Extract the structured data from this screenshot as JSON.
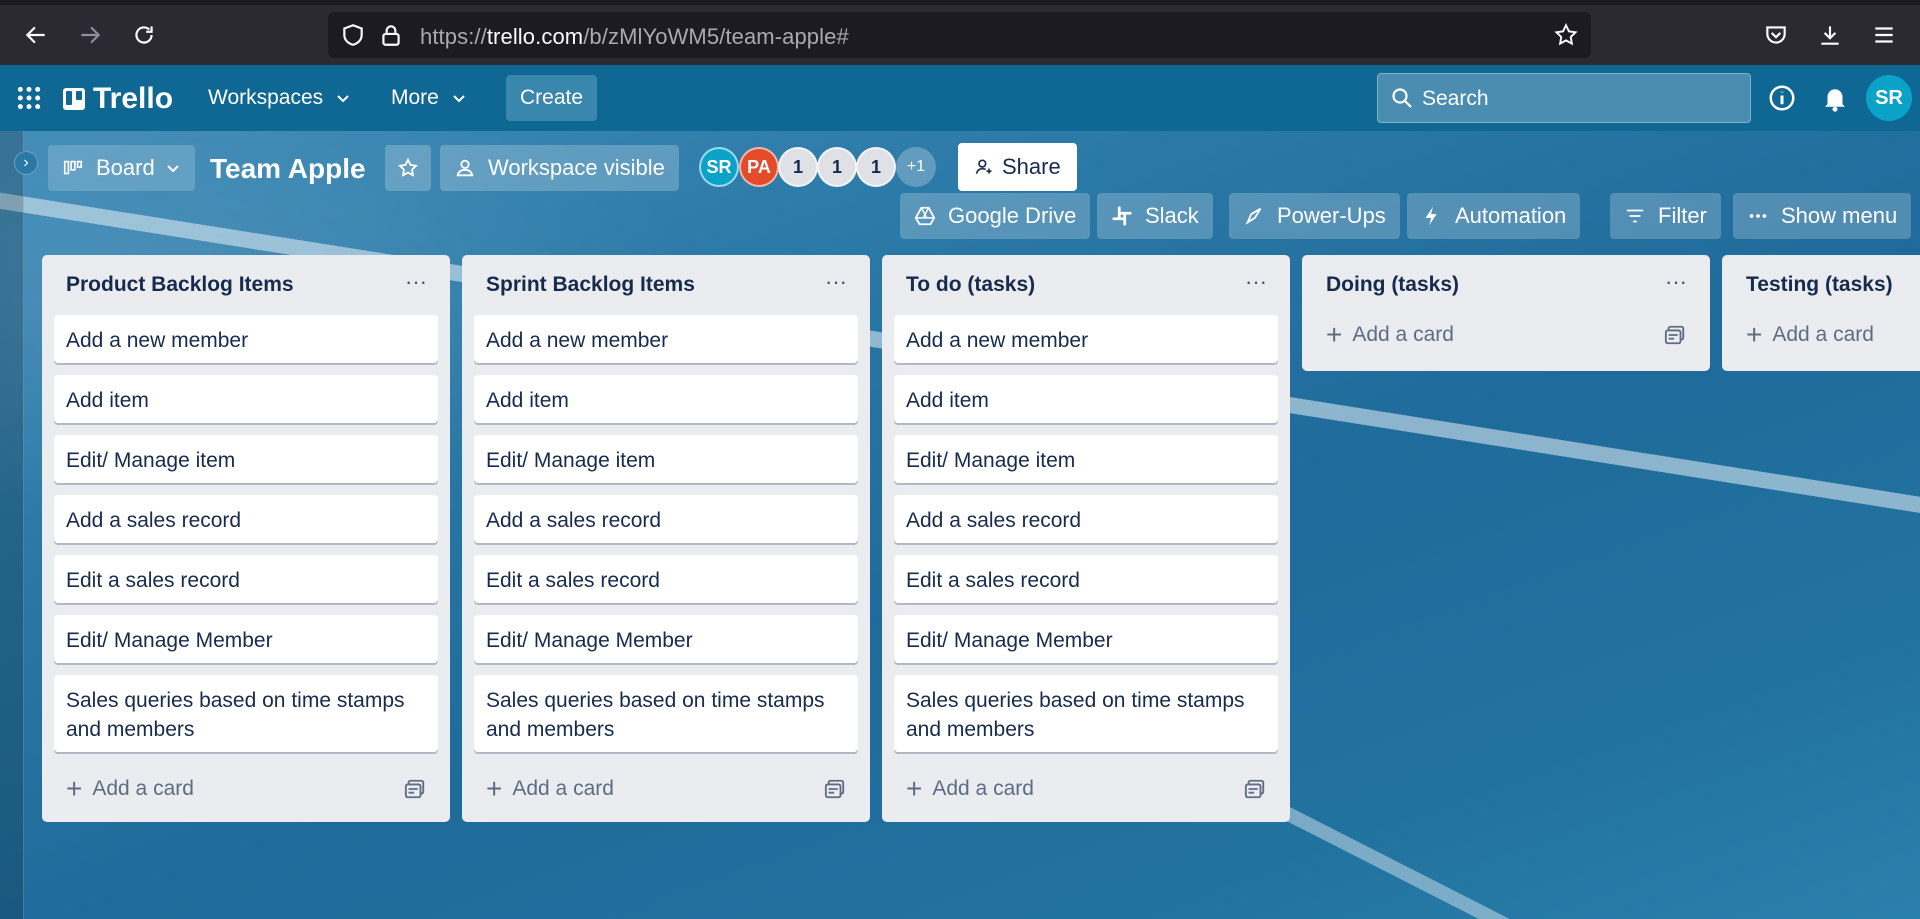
{
  "browser": {
    "url_prefix": "https://",
    "url_host": "trello.com",
    "url_path": "/b/zMlYoWM5/team-apple#"
  },
  "header": {
    "logo": "Trello",
    "workspaces": "Workspaces",
    "more": "More",
    "create": "Create",
    "search_placeholder": "Search",
    "avatar": "SR"
  },
  "board": {
    "view": "Board",
    "title": "Team Apple",
    "visibility": "Workspace visible",
    "members": [
      "SR",
      "PA",
      "1",
      "1",
      "1"
    ],
    "more_members": "+1",
    "share": "Share",
    "toolbar": [
      "Google Drive",
      "Slack",
      "Power-Ups",
      "Automation",
      "Filter",
      "Show menu"
    ],
    "add_card_label": "Add a card",
    "lists": [
      {
        "title": "Product Backlog Items",
        "cards": [
          "Add a new member",
          "Add item",
          "Edit/ Manage item",
          "Add a sales record",
          "Edit a sales record",
          "Edit/ Manage Member",
          "Sales queries based on time stamps and members"
        ]
      },
      {
        "title": "Sprint Backlog Items",
        "cards": [
          "Add a new member",
          "Add item",
          "Edit/ Manage item",
          "Add a sales record",
          "Edit a sales record",
          "Edit/ Manage Member",
          "Sales queries based on time stamps and members"
        ]
      },
      {
        "title": "To do (tasks)",
        "cards": [
          "Add a new member",
          "Add item",
          "Edit/ Manage item",
          "Add a sales record",
          "Edit a sales record",
          "Edit/ Manage Member",
          "Sales queries based on time stamps and members"
        ]
      },
      {
        "title": "Doing (tasks)",
        "cards": []
      },
      {
        "title": "Testing (tasks)",
        "cards": []
      }
    ]
  }
}
